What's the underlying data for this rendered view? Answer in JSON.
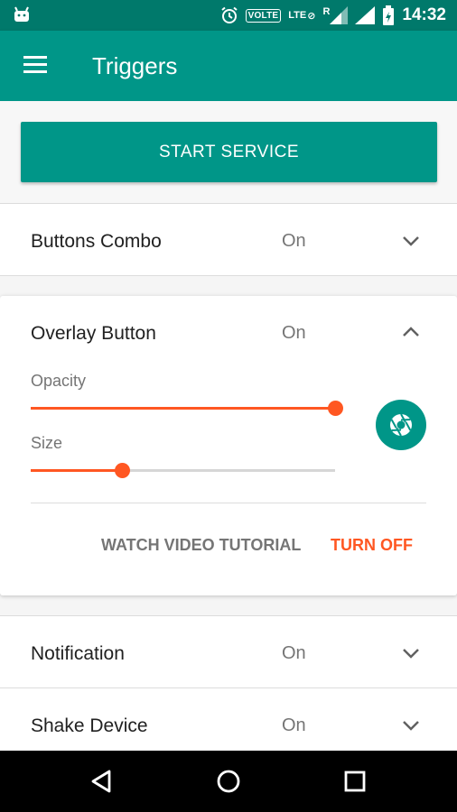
{
  "status_bar": {
    "time": "14:32",
    "volte_label": "VOLTE",
    "lte_label": "LTE",
    "roaming_label": "R",
    "icons": [
      "android-icon",
      "alarm-icon",
      "volte-icon",
      "data-off-icon",
      "signal-icon",
      "signal-icon",
      "battery-icon"
    ]
  },
  "app_bar": {
    "title": "Triggers",
    "menu_icon": "hamburger-menu-icon"
  },
  "service": {
    "start_label": "START SERVICE"
  },
  "triggers": [
    {
      "name": "Buttons Combo",
      "status": "On",
      "expanded": false
    },
    {
      "name": "Overlay Button",
      "status": "On",
      "expanded": true
    },
    {
      "name": "Notification",
      "status": "On",
      "expanded": false
    },
    {
      "name": "Shake Device",
      "status": "On",
      "expanded": false
    }
  ],
  "overlay_settings": {
    "opacity_label": "Opacity",
    "opacity_value": 1.0,
    "size_label": "Size",
    "size_value": 0.3,
    "button_icon": "camera-shutter-icon",
    "tutorial_label": "WATCH VIDEO TUTORIAL",
    "turn_off_label": "TURN OFF"
  },
  "colors": {
    "primary": "#009688",
    "primary_dark": "#00796b",
    "accent": "#ff5722"
  },
  "nav_bar": {
    "icons": [
      "back-icon",
      "home-icon",
      "recents-icon"
    ]
  }
}
